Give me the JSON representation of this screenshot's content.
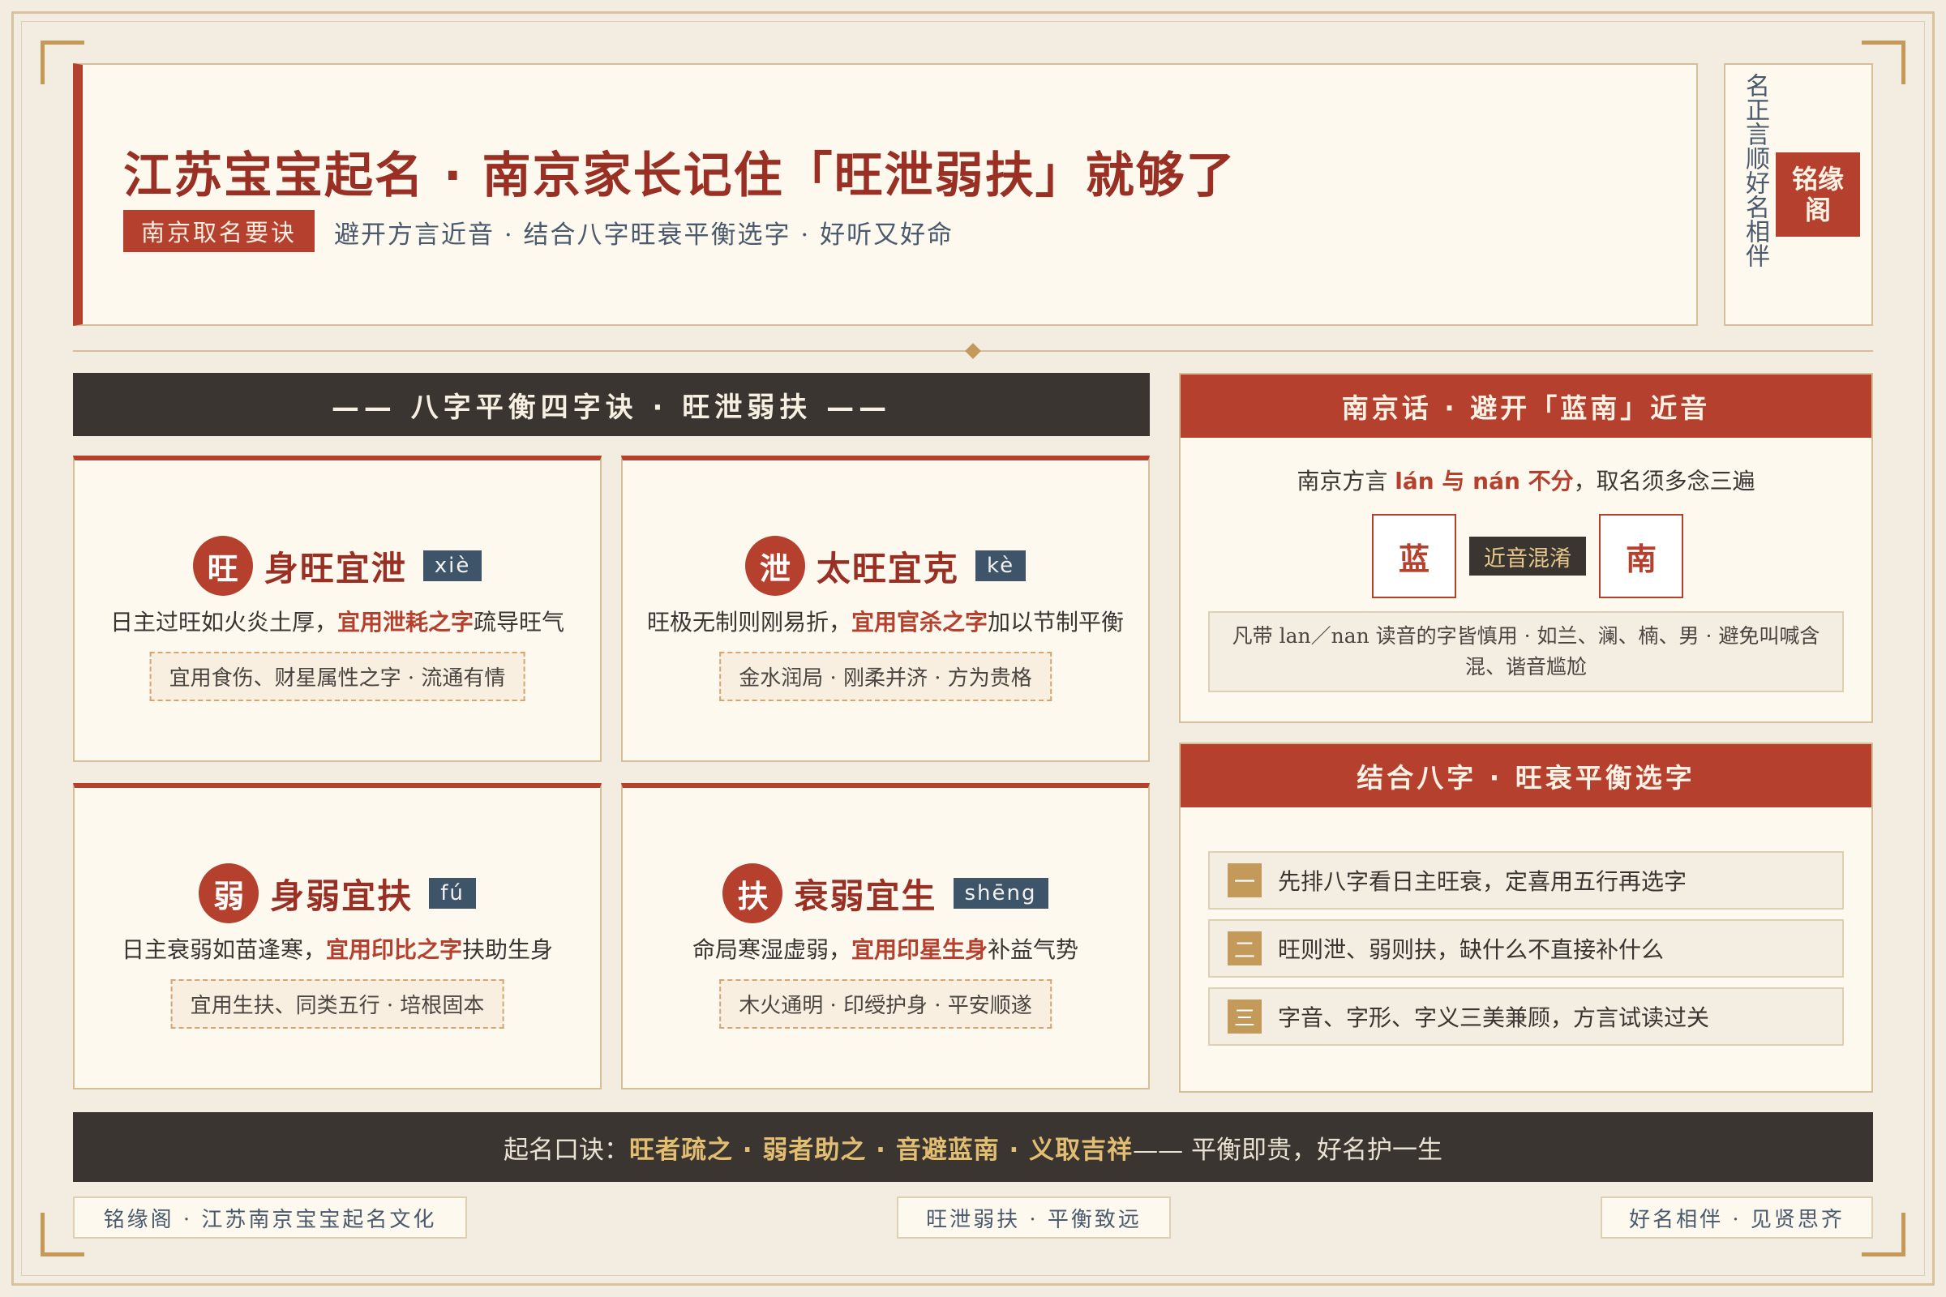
{
  "header": {
    "title": "江苏宝宝起名 · 南京家长记住「旺泄弱扶」就够了",
    "tag": "南京取名要诀",
    "subtitle": "避开方言近音 · 结合八字旺衰平衡选字 · 好听又好命",
    "motto": "名正言顺好名相伴",
    "seal": "铭缘阁"
  },
  "section_title": "—— 八字平衡四字诀 · 旺泄弱扶 ——",
  "cards": [
    {
      "char": "旺",
      "title": "身旺宜泄",
      "pinyin": "xiè",
      "desc_before": "日主过旺如火炎土厚，",
      "desc_hl": "宜用泄耗之字",
      "desc_after": "疏导旺气",
      "note": "宜用食伤、财星属性之字 · 流通有情"
    },
    {
      "char": "泄",
      "title": "太旺宜克",
      "pinyin": "kè",
      "desc_before": "旺极无制则刚易折，",
      "desc_hl": "宜用官杀之字",
      "desc_after": "加以节制平衡",
      "note": "金水润局 · 刚柔并济 · 方为贵格"
    },
    {
      "char": "弱",
      "title": "身弱宜扶",
      "pinyin": "fú",
      "desc_before": "日主衰弱如苗逢寒，",
      "desc_hl": "宜用印比之字",
      "desc_after": "扶助生身",
      "note": "宜用生扶、同类五行 · 培根固本"
    },
    {
      "char": "扶",
      "title": "衰弱宜生",
      "pinyin": "shēng",
      "desc_before": "命局寒湿虚弱，",
      "desc_hl": "宜用印星生身",
      "desc_after": "补益气势",
      "note": "木火通明 · 印绶护身 · 平安顺遂"
    }
  ],
  "dialect": {
    "heading": "南京话 · 避开「蓝南」近音",
    "line_before": "南京方言 ",
    "line_hl": "lán 与 nán 不分",
    "line_after": "，取名须多念三遍",
    "char_left": "蓝",
    "mid": "近音混淆",
    "char_right": "南",
    "warning": "凡带 lan／nan 读音的字皆慎用 · 如兰、澜、楠、男 · 避免叫喊含混、谐音尴尬"
  },
  "bazi": {
    "heading": "结合八字 · 旺衰平衡选字",
    "steps": [
      {
        "num": "一",
        "text": "先排八字看日主旺衰，定喜用五行再选字"
      },
      {
        "num": "二",
        "text": "旺则泄、弱则扶，缺什么不直接补什么"
      },
      {
        "num": "三",
        "text": "字音、字形、字义三美兼顾，方言试读过关"
      }
    ]
  },
  "formula": {
    "prefix": "起名口诀：",
    "hl": "旺者疏之 · 弱者助之 · 音避蓝南 · 义取吉祥",
    "suffix": " —— 平衡即贵，好名护一生"
  },
  "footer": {
    "left": "铭缘阁 · 江苏南京宝宝起名文化",
    "center": "旺泄弱扶 · 平衡致远",
    "right": "好名相伴 · 见贤思齐"
  },
  "colors": {
    "accent": "#b5402e",
    "dark": "#3a3530",
    "gold": "#c49a5a",
    "paper": "#fdf9ef",
    "pinyin_bg": "#3e5468"
  }
}
